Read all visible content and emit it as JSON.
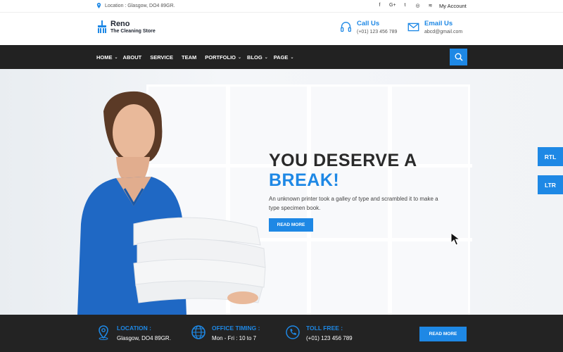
{
  "topbar": {
    "location": "Location : Glasgow, DO4 89GR.",
    "social_icons": [
      "facebook-icon",
      "google-plus-icon",
      "twitter-icon",
      "instagram-icon",
      "rss-icon"
    ],
    "social_glyphs": [
      "f",
      "G+",
      "t",
      "◎",
      "≋"
    ],
    "account": "My Account"
  },
  "brand": {
    "name": "Reno",
    "tagline": "The Cleaning Store"
  },
  "contacts": [
    {
      "title": "Call Us",
      "value": "(+01) 123 456 789",
      "icon": "headset-icon"
    },
    {
      "title": "Email Us",
      "value": "abcd@gmail.com",
      "icon": "envelope-icon"
    }
  ],
  "nav": {
    "items": [
      {
        "label": "HOME",
        "dropdown": true
      },
      {
        "label": "ABOUT",
        "dropdown": false
      },
      {
        "label": "SERVICE",
        "dropdown": false
      },
      {
        "label": "TEAM",
        "dropdown": false
      },
      {
        "label": "PORTFOLIO",
        "dropdown": true
      },
      {
        "label": "BLOG",
        "dropdown": true
      },
      {
        "label": "PAGE",
        "dropdown": true
      }
    ],
    "chevron": "⌄"
  },
  "hero": {
    "title_line1": "YOU DESERVE A",
    "title_line2": "BREAK!",
    "description": "An unknown printer took a galley of type and scrambled it to make a type specimen book.",
    "button": "READ MORE"
  },
  "side_buttons": {
    "rtl": "RTL",
    "ltr": "LTR"
  },
  "footer": {
    "items": [
      {
        "label": "LOCATION :",
        "value": "Glasgow, DO4 89GR.",
        "icon": "map-pin-icon"
      },
      {
        "label": "OFFICE TIMING :",
        "value": "Mon - Fri : 10 to 7",
        "icon": "globe-icon"
      },
      {
        "label": "TOLL FREE :",
        "value": "(+01) 123 456 789",
        "icon": "phone-icon"
      }
    ],
    "button": "READ MORE"
  },
  "colors": {
    "accent": "#1e88e5",
    "dark": "#222222",
    "footer": "#232323"
  }
}
